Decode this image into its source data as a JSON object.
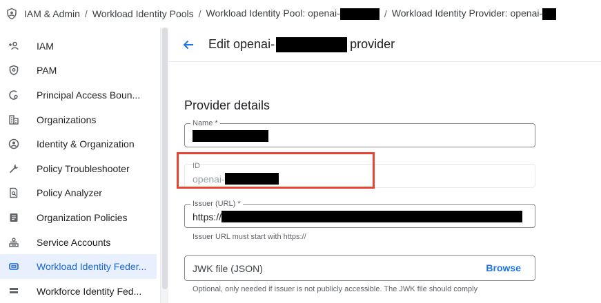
{
  "breadcrumb": {
    "items": [
      "IAM & Admin",
      "Workload Identity Pools",
      "Workload Identity Pool: openai-",
      "Workload Identity Provider: openai-"
    ],
    "separator": "/"
  },
  "sidebar": {
    "items": [
      {
        "label": "IAM",
        "icon": "person-add-icon"
      },
      {
        "label": "PAM",
        "icon": "shield-icon"
      },
      {
        "label": "Principal Access Boun...",
        "icon": "principal-access-icon"
      },
      {
        "label": "Organizations",
        "icon": "organizations-icon"
      },
      {
        "label": "Identity & Organization",
        "icon": "account-circle-icon"
      },
      {
        "label": "Policy Troubleshooter",
        "icon": "wrench-icon"
      },
      {
        "label": "Policy Analyzer",
        "icon": "policy-analyzer-icon"
      },
      {
        "label": "Organization Policies",
        "icon": "organization-policies-icon"
      },
      {
        "label": "Service Accounts",
        "icon": "service-account-icon"
      },
      {
        "label": "Workload Identity Feder...",
        "icon": "workload-identity-icon",
        "active": true
      },
      {
        "label": "Workforce Identity Fed...",
        "icon": "workforce-identity-icon"
      }
    ]
  },
  "header": {
    "title_prefix": "Edit openai-",
    "title_suffix": "provider"
  },
  "form": {
    "section_title": "Provider details",
    "name_label": "Name *",
    "id_label": "ID",
    "id_value_prefix": "openai-",
    "issuer_label": "Issuer (URL) *",
    "issuer_value_prefix": "https://",
    "issuer_helper": "Issuer URL must start with https://",
    "jwk_label": "JWK file (JSON)",
    "browse_label": "Browse",
    "jwk_helper": "Optional, only needed if issuer is not publicly accessible. The JWK file should comply"
  },
  "colors": {
    "accent": "#1a73e8",
    "active_bg": "#e8f0fe",
    "highlight": "#e8432e"
  }
}
